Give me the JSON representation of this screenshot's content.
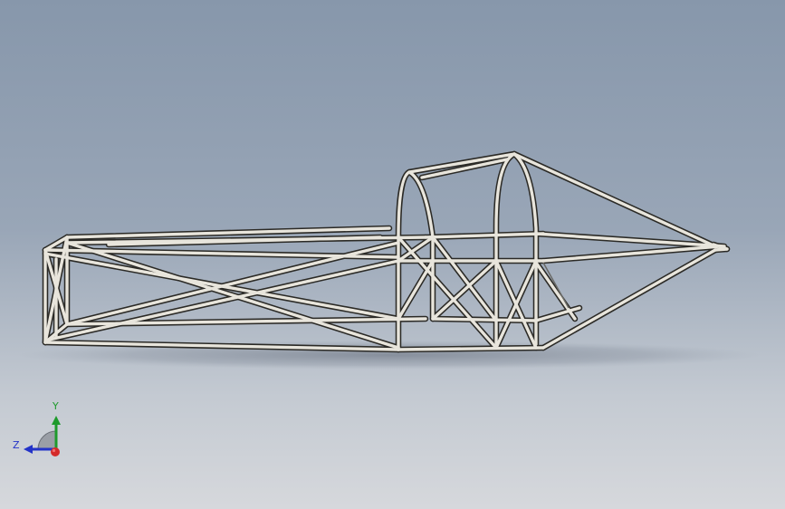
{
  "viewport": {
    "background_top": "#8797ab",
    "background_bottom": "#d6d8dc",
    "model": "tube-frame-chassis"
  },
  "model": {
    "tube_color": "#e8e5dc",
    "tube_outline": "#2b2a26",
    "shadow_color": "#6f7887"
  },
  "triad": {
    "y_label": "Y",
    "z_label": "Z",
    "y_color": "#1e9a2c",
    "z_color": "#2333c8",
    "x_color": "#d42a2a"
  }
}
